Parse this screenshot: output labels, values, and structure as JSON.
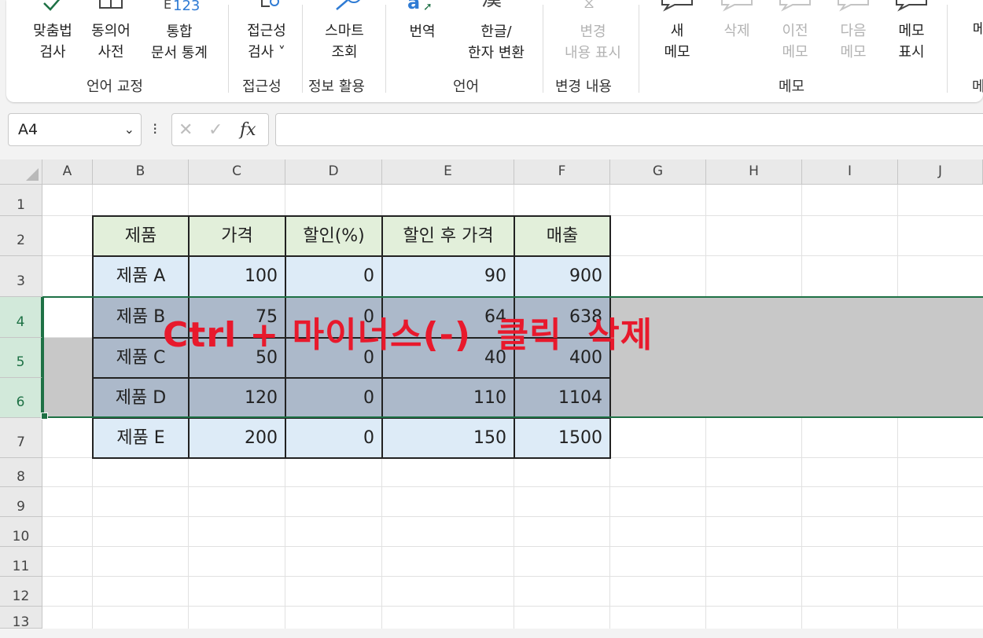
{
  "ribbon": {
    "groups": [
      {
        "label": "언어 교정",
        "buttons": [
          {
            "line1": "맞춤법",
            "line2": "검사"
          },
          {
            "line1": "동의어",
            "line2": "사전"
          },
          {
            "line1": "통합",
            "line2": "문서 통계",
            "icon_text": "123"
          }
        ]
      },
      {
        "label": "접근성",
        "buttons": [
          {
            "line1": "접근성",
            "line2": "검사 ˅"
          }
        ]
      },
      {
        "label": "정보 활용",
        "buttons": [
          {
            "line1": "스마트",
            "line2": "조회"
          }
        ]
      },
      {
        "label": "언어",
        "buttons": [
          {
            "line1": "번역",
            "line2": ""
          },
          {
            "line1": "한글/",
            "line2": "한자 변환"
          }
        ]
      },
      {
        "label": "변경 내용",
        "buttons": [
          {
            "line1": "변경",
            "line2": "내용 표시",
            "disabled": true
          }
        ]
      },
      {
        "label": "메모",
        "buttons": [
          {
            "line1": "새",
            "line2": "메모"
          },
          {
            "line1": "삭제",
            "line2": "",
            "disabled": true
          },
          {
            "line1": "이전",
            "line2": "메모",
            "disabled": true
          },
          {
            "line1": "다음",
            "line2": "메모",
            "disabled": true
          },
          {
            "line1": "메모",
            "line2": "표시"
          }
        ]
      }
    ],
    "partial_button": "메",
    "partial_label": "메"
  },
  "formula_bar": {
    "name_box": "A4",
    "cancel_symbol": "✕",
    "enter_symbol": "✓",
    "fx_label": "fx",
    "kebab": "⁝",
    "formula": ""
  },
  "sheet": {
    "columns": [
      "A",
      "B",
      "C",
      "D",
      "E",
      "F",
      "G",
      "H",
      "I",
      "J"
    ],
    "rows": [
      "1",
      "2",
      "3",
      "4",
      "5",
      "6",
      "7",
      "8",
      "9",
      "10",
      "11",
      "12",
      "13"
    ],
    "selected_rows": [
      "4",
      "5",
      "6"
    ],
    "table": {
      "headers": [
        "제품",
        "가격",
        "할인(%)",
        "할인 후 가격",
        "매출"
      ],
      "rows": [
        [
          "제품 A",
          "100",
          "0",
          "90",
          "900"
        ],
        [
          "제품 B",
          "75",
          "0",
          "64",
          "638"
        ],
        [
          "제품 C",
          "50",
          "0",
          "40",
          "400"
        ],
        [
          "제품 D",
          "120",
          "0",
          "110",
          "1104"
        ],
        [
          "제품 E",
          "200",
          "0",
          "150",
          "1500"
        ]
      ]
    }
  },
  "annotation": "Ctrl + 마이너스(-)  클릭  삭제",
  "colors": {
    "excel_green": "#1e7145",
    "header_fill": "#e2efda",
    "body_fill": "#ddebf7",
    "selected_fill": "#acb9ca",
    "annotation_red": "#e8192c"
  }
}
